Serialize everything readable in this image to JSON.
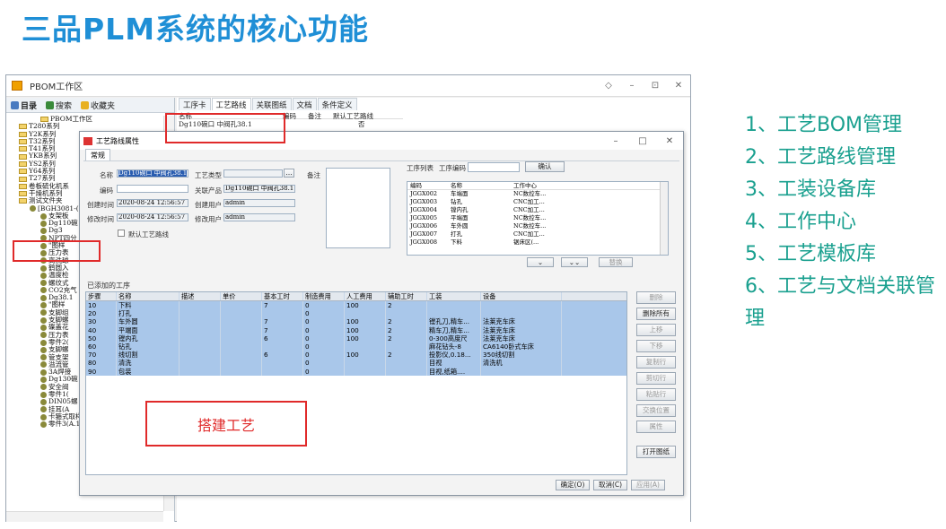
{
  "slide": {
    "title": "三品PLM系统的核心功能",
    "features": [
      "1、工艺BOM管理",
      "2、工艺路线管理",
      "3、工装设备库",
      "4、工作中心",
      "5、工艺模板库",
      "6、工艺与文档关联管理"
    ],
    "annotation": "搭建工艺",
    "accent": "#1f8fd6",
    "feature_color": "#1aa08f",
    "highlight_color": "#e02a2a"
  },
  "window": {
    "title": "PBOM工作区",
    "controls": [
      "◇",
      "–",
      "⊡",
      "✕"
    ],
    "left_tabs": [
      "目录",
      "搜索",
      "收藏夹"
    ],
    "tree": [
      "PBOM工作区",
      "T280系列",
      "Y2K系列",
      "T32系列",
      "T41系列",
      "YKB系列",
      "YS2系列",
      "Y64系列",
      "T27系列",
      "卷板硫化机系",
      "干燥机系列",
      "测试文件夹",
      "[BGH3081-(",
      "支架板",
      "Dg110碗",
      "Dg3 ",
      "NPT四分",
      "\"图样",
      "压力表",
      "离洗球",
      "鹤圆入",
      "温度检",
      "螺纹式",
      "CO2充气",
      "Dg38.1",
      "\"图样",
      "支脚组",
      "支脚螺",
      "碟盖花",
      "压力表",
      "零件2(",
      "支脚螺",
      "管支架",
      "溢流管",
      "3A焊接",
      "Dg130碗",
      "安全阀",
      "零件1(",
      "DIN05螺",
      "挂耳(A",
      "卡箍式取样阀(A.1)",
      "零件3(A.1)"
    ],
    "right_tabs": [
      "工序卡",
      "工艺路线",
      "关联图纸",
      "文档",
      "条件定义"
    ],
    "route_header": [
      "名称",
      "编码",
      "备注",
      "默认工艺路线"
    ],
    "route_row": [
      "Dg110碗口 中阀孔38.1",
      "否"
    ]
  },
  "dialog": {
    "title": "工艺路线属性",
    "tab": "常规",
    "controls": [
      "–",
      "□",
      "✕"
    ],
    "fields": {
      "name_label": "名称",
      "name_value": "Dg110碗口 中阀孔38.1",
      "type_label": "工艺类型",
      "type_value": "",
      "remark_label": "备注",
      "code_label": "编码",
      "code_value": "",
      "product_label": "关联产品",
      "product_value": "Dg110碗口 中阀孔38.1",
      "ctime_label": "创建时间",
      "ctime_value": "2020-08-24 12:56:57",
      "cuser_label": "创建用户",
      "cuser_value": "admin",
      "mtime_label": "修改时间",
      "mtime_value": "2020-08-24 12:56:57",
      "muser_label": "修改用户",
      "muser_value": "admin",
      "default_label": "默认工艺路线"
    },
    "ops": {
      "list_label": "工序列表",
      "code_search_label": "工序编码",
      "confirm": "确认",
      "headers": [
        "编码",
        "名称",
        "工作中心"
      ],
      "rows": [
        [
          "JGGX002",
          "车端面",
          "NC数控车..."
        ],
        [
          "JGGX003",
          "钻孔",
          "CNC加工..."
        ],
        [
          "JGGX004",
          "镗内孔",
          "CNC加工..."
        ],
        [
          "JGGX005",
          "平端面",
          "NC数控车..."
        ],
        [
          "JGGX006",
          "车外圆",
          "NC数控车..."
        ],
        [
          "JGGX007",
          "打孔",
          "CNC加工..."
        ],
        [
          "JGGX008",
          "下料",
          "锯床区(..."
        ]
      ],
      "btn_down": "⌄",
      "btn_bottom": "⌄⌄",
      "btn_replace": "替换"
    },
    "added_label": "已添加的工序",
    "grid_headers": [
      "步骤",
      "名称",
      "描述",
      "单价",
      "基本工时",
      "制造费用",
      "人工费用",
      "辅助工时",
      "工装",
      "设备"
    ],
    "grid_rows": [
      [
        "10",
        "下料",
        "",
        "",
        "7",
        "0",
        "100",
        "2",
        "",
        ""
      ],
      [
        "20",
        "打孔",
        "",
        "",
        "",
        "0",
        "",
        "",
        "",
        ""
      ],
      [
        "30",
        "车外圆",
        "",
        "",
        "7",
        "0",
        "100",
        "2",
        "镗孔刀,精车...",
        "法莱克车床"
      ],
      [
        "40",
        "平端面",
        "",
        "",
        "7",
        "0",
        "100",
        "2",
        "精车刀,精车...",
        "法莱克车床"
      ],
      [
        "50",
        "镗内孔",
        "",
        "",
        "6",
        "0",
        "100",
        "2",
        "0-300高度尺",
        "法莱克车床"
      ],
      [
        "60",
        "钻孔",
        "",
        "",
        "",
        "0",
        "",
        "",
        "麻花钻头-8",
        "CA6140卧式车床"
      ],
      [
        "70",
        "线切割",
        "",
        "",
        "6",
        "0",
        "100",
        "2",
        "投影仪,0.18...",
        "350线切割"
      ],
      [
        "80",
        "清洗",
        "",
        "",
        "",
        "0",
        "",
        "",
        "目视",
        "清洗机"
      ],
      [
        "90",
        "包装",
        "",
        "",
        "",
        "0",
        "",
        "",
        "目视,纸箱....",
        ""
      ]
    ],
    "side_buttons": [
      "删除",
      "删除所有",
      "上移",
      "下移",
      "复制行",
      "剪切行",
      "粘贴行",
      "交换位置",
      "属性",
      "打开图纸"
    ],
    "bottom_buttons": [
      "确定(O)",
      "取消(C)",
      "应用(A)"
    ]
  }
}
